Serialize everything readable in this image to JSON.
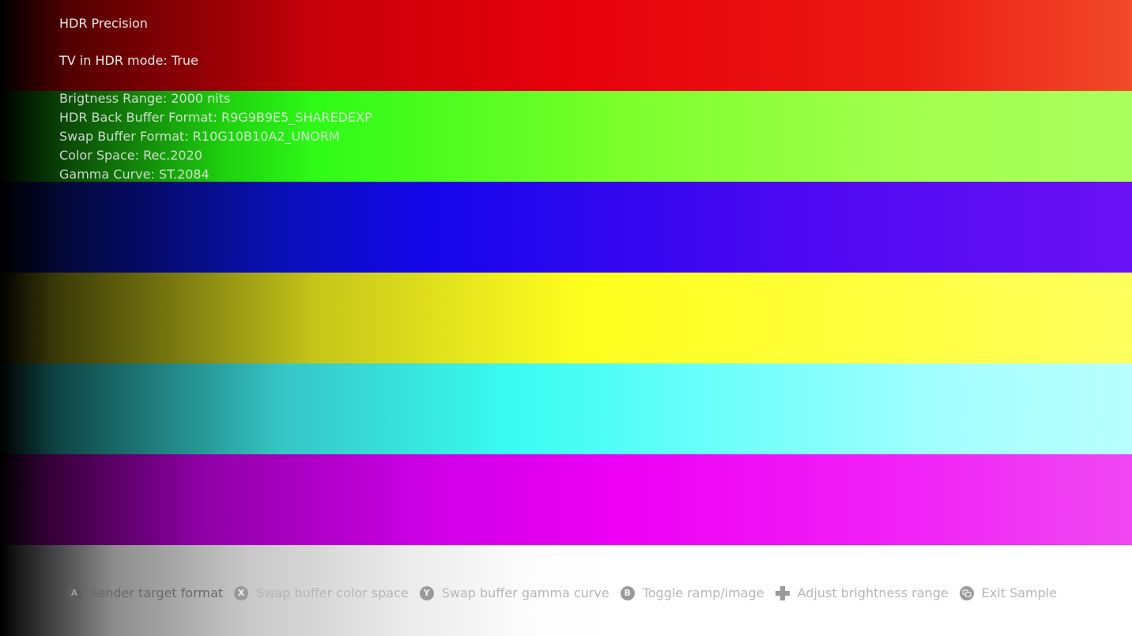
{
  "app": {
    "title": "HDR Precision"
  },
  "status": {
    "tv_hdr_mode": "TV in HDR mode: True",
    "lines": [
      "Brigtness Range: 2000 nits",
      "HDR Back Buffer Format: R9G9B9E5_SHAREDEXP",
      "Swap Buffer Format: R10G10B10A2_UNORM",
      "Color Space: Rec.2020",
      "Gamma Curve: ST.2084"
    ]
  },
  "ramps": {
    "colors": [
      "red",
      "green",
      "blue",
      "yellow",
      "cyan",
      "magenta",
      "white"
    ]
  },
  "footer": {
    "hints": [
      {
        "button": "A",
        "label": "Render target format"
      },
      {
        "button": "X",
        "label": "Swap buffer color space"
      },
      {
        "button": "Y",
        "label": "Swap buffer gamma curve"
      },
      {
        "button": "B",
        "label": "Toggle ramp/image"
      },
      {
        "button": "",
        "icon": "dpad-icon",
        "label": "Adjust brightness range"
      },
      {
        "button": "",
        "icon": "view-button-icon",
        "label": "Exit Sample"
      }
    ]
  }
}
